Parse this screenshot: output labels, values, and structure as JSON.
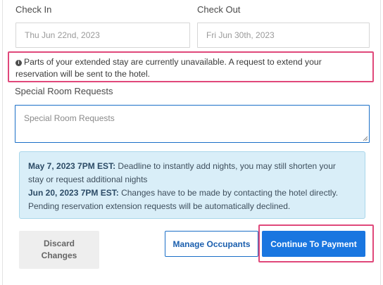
{
  "dates": {
    "check_in_label": "Check In",
    "check_in_value": "Thu Jun 22nd, 2023",
    "check_out_label": "Check Out",
    "check_out_value": "Fri Jun 30th, 2023"
  },
  "warning": {
    "icon": "info-icon",
    "line1": "Parts of your extended stay are currently unavailable. A request to extend your",
    "line2": "reservation will be sent to the hotel."
  },
  "special_requests": {
    "label": "Special Room Requests",
    "placeholder": "Special Room Requests"
  },
  "deadlines": [
    {
      "date": "May 7, 2023 7PM EST:",
      "text1": " Deadline to instantly add nights, you may still shorten your",
      "text2": "stay or request additional nights"
    },
    {
      "date": "Jun 20, 2023 7PM EST:",
      "text1": " Changes have to be made by contacting the hotel directly.",
      "text2": "Pending reservation extension requests will be automatically declined."
    }
  ],
  "actions": {
    "discard_line1": "Discard",
    "discard_line2": "Changes",
    "manage": "Manage Occupants",
    "continue": "Continue To Payment"
  },
  "colors": {
    "accent": "#1976e0",
    "highlight": "#e0487a",
    "info_bg": "#d9eef8"
  }
}
